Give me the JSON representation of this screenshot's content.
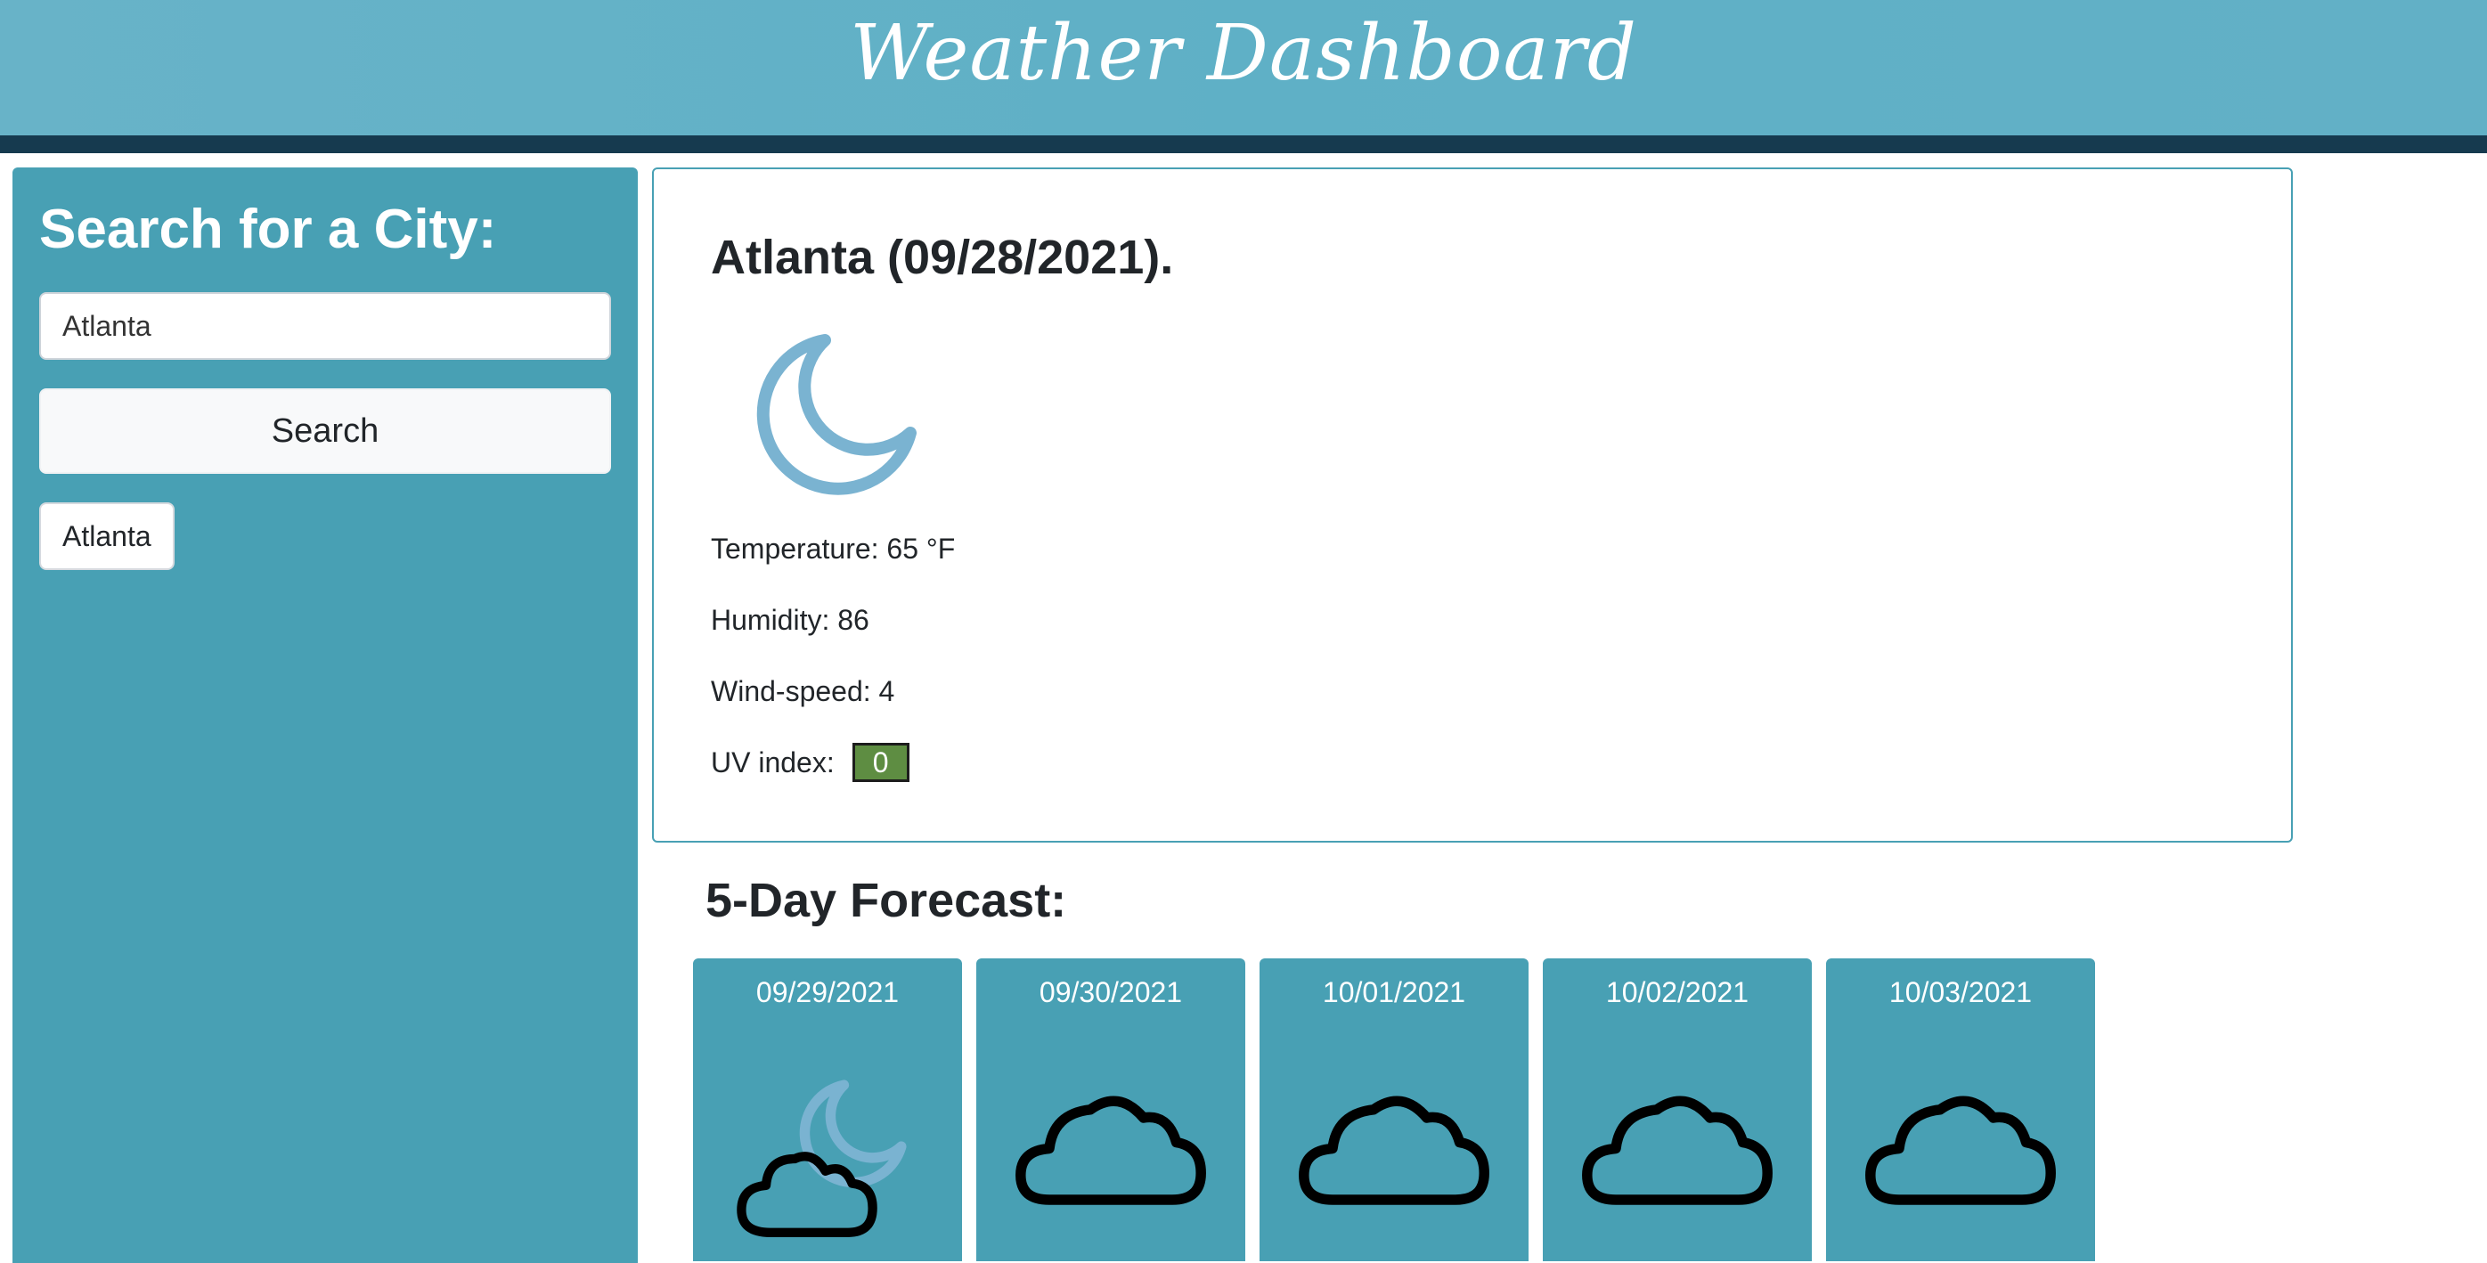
{
  "header": {
    "title": "Weather Dashboard"
  },
  "sidebar": {
    "title": "Search for a City:",
    "search_value": "Atlanta",
    "search_button": "Search",
    "history": [
      "Atlanta"
    ]
  },
  "current": {
    "title": "Atlanta (09/28/2021).",
    "icon": "moon-icon",
    "temperature": "Temperature: 65 °F",
    "humidity": "Humidity: 86",
    "wind": "Wind-speed: 4",
    "uv_label": "UV index:",
    "uv_value": "0"
  },
  "forecast": {
    "title": "5-Day Forecast:",
    "days": [
      {
        "date": "09/29/2021",
        "icon": "partly-cloudy-night-icon"
      },
      {
        "date": "09/30/2021",
        "icon": "cloud-icon"
      },
      {
        "date": "10/01/2021",
        "icon": "cloud-icon"
      },
      {
        "date": "10/02/2021",
        "icon": "cloud-icon"
      },
      {
        "date": "10/03/2021",
        "icon": "cloud-icon"
      }
    ]
  },
  "colors": {
    "header_bg": "#62b0c6",
    "header_bar": "#163a4f",
    "panel_bg": "#48a0b4",
    "uv_green": "#5e8d42",
    "moon_blue": "#7ab3d1"
  }
}
